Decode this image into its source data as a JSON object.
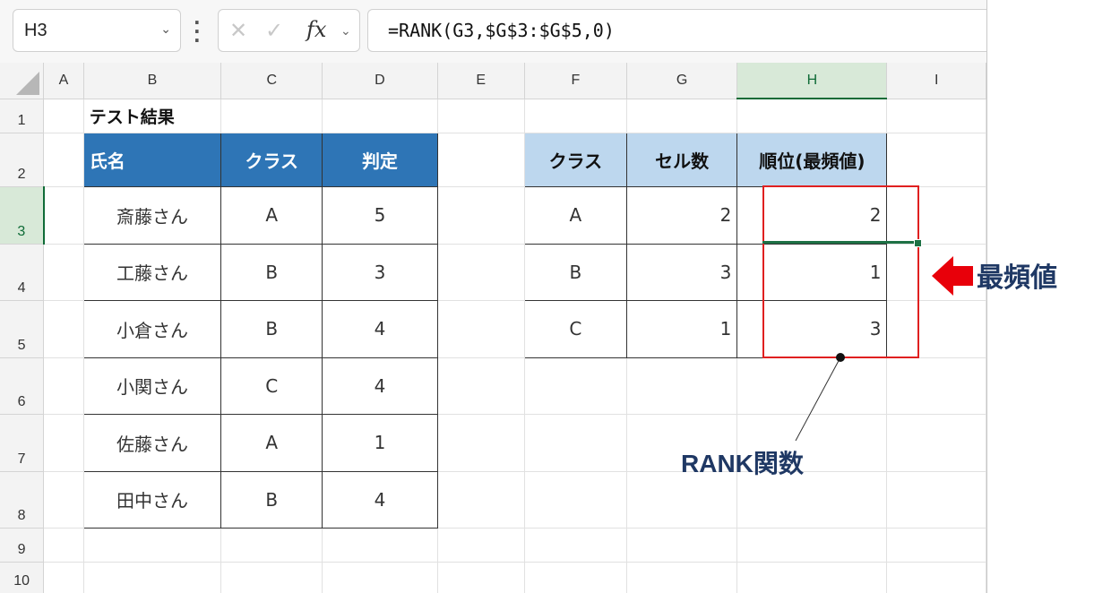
{
  "formula_bar": {
    "name_box": "H3",
    "fx_label": "fx",
    "cancel_symbol": "✕",
    "enter_symbol": "✓",
    "formula": "=RANK(G3,$G$3:$G$5,0)"
  },
  "columns": [
    "A",
    "B",
    "C",
    "D",
    "E",
    "F",
    "G",
    "H",
    "I"
  ],
  "rows": [
    "1",
    "2",
    "3",
    "4",
    "5",
    "6",
    "7",
    "8",
    "9",
    "10"
  ],
  "selected_cell": {
    "column": "H",
    "row": "3"
  },
  "left_table": {
    "title": "テスト結果",
    "headers": [
      "氏名",
      "クラス",
      "判定"
    ],
    "rows": [
      [
        "斎藤さん",
        "A",
        "5"
      ],
      [
        "工藤さん",
        "B",
        "3"
      ],
      [
        "小倉さん",
        "B",
        "4"
      ],
      [
        "小関さん",
        "C",
        "4"
      ],
      [
        "佐藤さん",
        "A",
        "1"
      ],
      [
        "田中さん",
        "B",
        "4"
      ]
    ]
  },
  "right_table": {
    "headers": [
      "クラス",
      "セル数",
      "順位(最頻値)"
    ],
    "rows": [
      [
        "A",
        "2",
        "2"
      ],
      [
        "B",
        "3",
        "1"
      ],
      [
        "C",
        "1",
        "3"
      ]
    ]
  },
  "annotations": {
    "arrow_label": "最頻値",
    "function_label": "RANK関数",
    "highlight_color": "#e02020",
    "label_color": "#1f3864"
  }
}
